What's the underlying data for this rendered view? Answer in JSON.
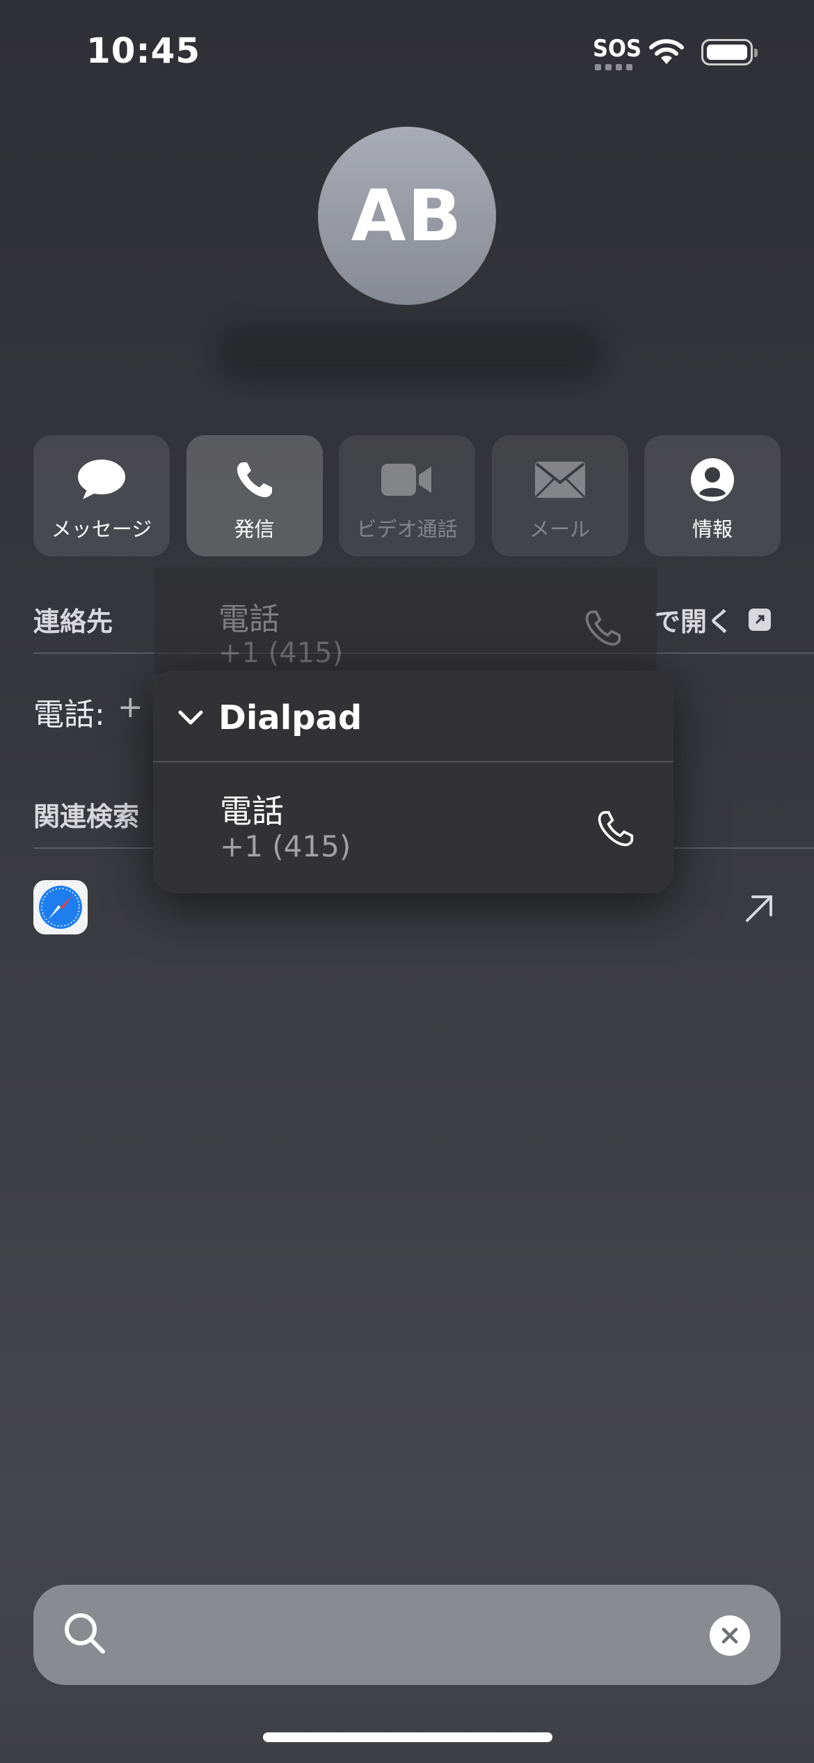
{
  "status_bar": {
    "time": "10:45",
    "sos": "SOS"
  },
  "contact": {
    "initials": "AB"
  },
  "actions": [
    {
      "label": "メッセージ",
      "icon": "message-bubble-icon",
      "state": "normal"
    },
    {
      "label": "発信",
      "icon": "phone-icon",
      "state": "active"
    },
    {
      "label": "ビデオ通話",
      "icon": "video-camera-icon",
      "state": "disabled"
    },
    {
      "label": "メール",
      "icon": "envelope-icon",
      "state": "disabled"
    },
    {
      "label": "情報",
      "icon": "person-circle-icon",
      "state": "normal"
    }
  ],
  "sections": {
    "contacts_label": "連絡先",
    "open_in_label": "で開く",
    "phone_label": "電話:",
    "phone_prefix": "+",
    "related_search_label": "関連検索"
  },
  "ghost_menu": {
    "title": "電話",
    "number": "+1 (415)"
  },
  "call_menu": {
    "header": "Dialpad",
    "item": {
      "title": "電話",
      "number": "+1 (415)"
    }
  },
  "search": {
    "value": ""
  },
  "colors": {
    "background": "#35363b",
    "menu": "#323235",
    "search_bar": "#8a8b90"
  }
}
